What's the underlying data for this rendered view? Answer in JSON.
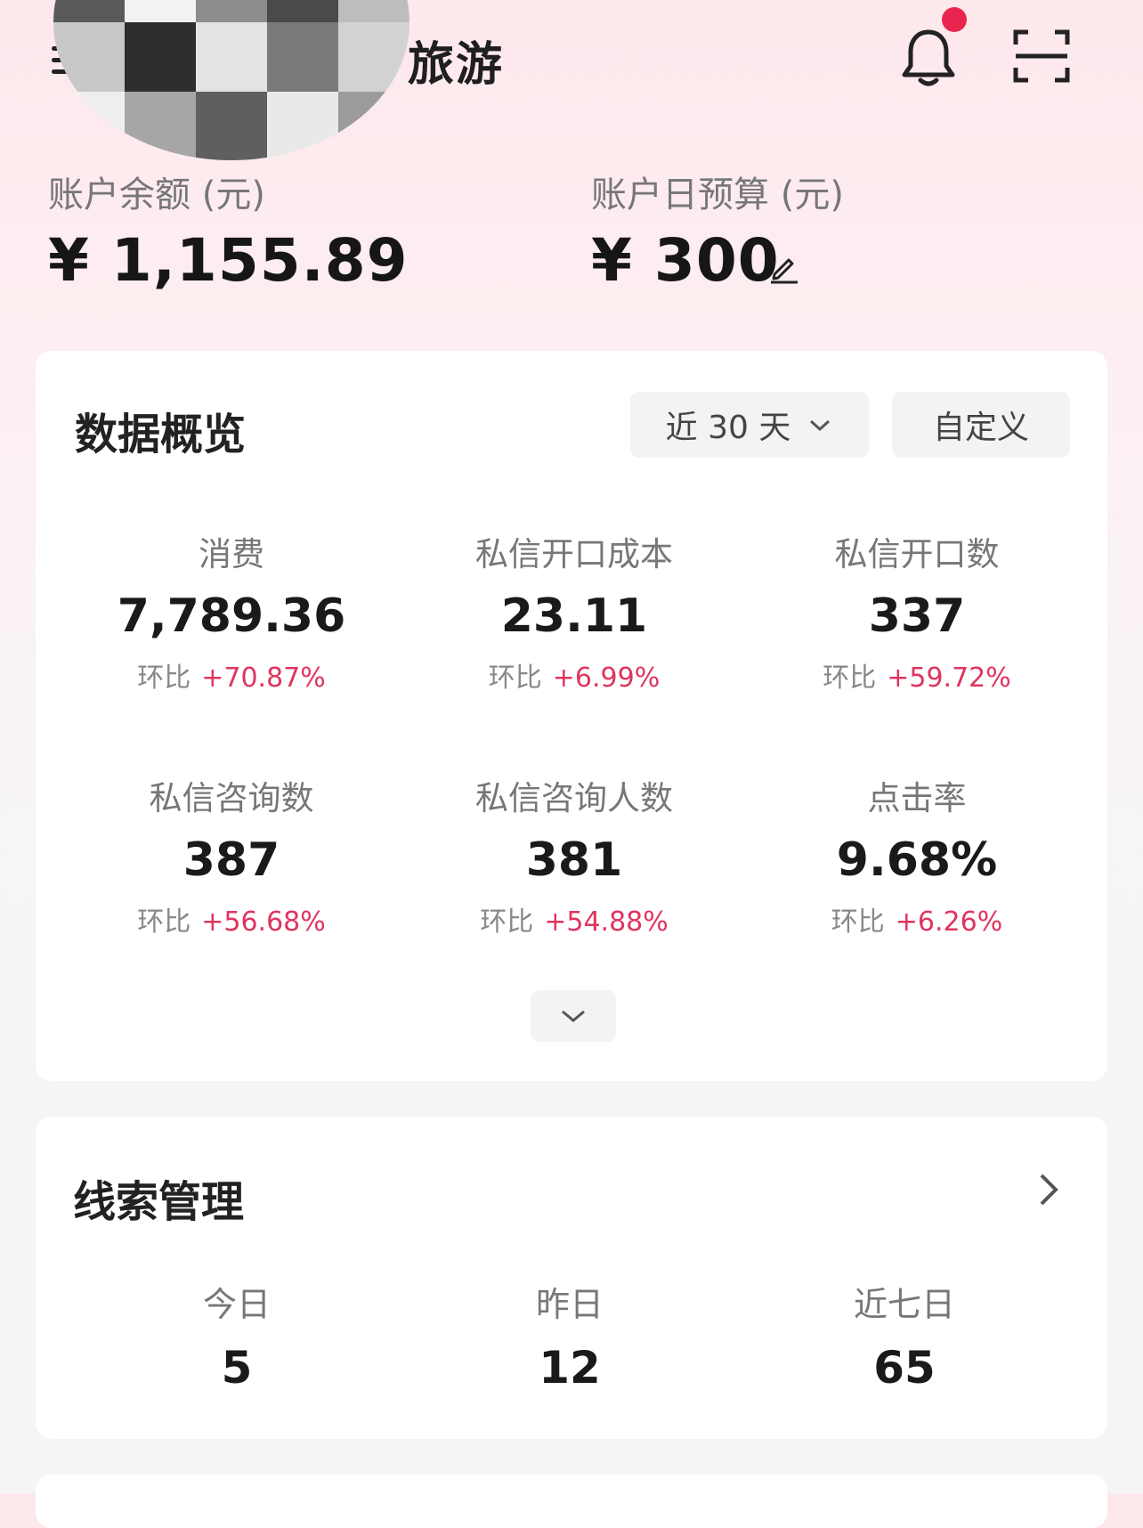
{
  "header": {
    "brand_partial": "旅游",
    "notification_has_unread": true,
    "accent_color": "#e8254f"
  },
  "account": {
    "balance_label": "账户余额 (元)",
    "balance_value": "¥ 1,155.89",
    "daily_budget_label": "账户日预算 (元)",
    "daily_budget_value": "¥ 300"
  },
  "overview": {
    "title": "数据概览",
    "range_label": "近 30 天",
    "custom_label": "自定义",
    "metrics": [
      {
        "label": "消费",
        "value": "7,789.36",
        "change_label": "环比",
        "change": "+70.87%"
      },
      {
        "label": "私信开口成本",
        "value": "23.11",
        "change_label": "环比",
        "change": "+6.99%"
      },
      {
        "label": "私信开口数",
        "value": "337",
        "change_label": "环比",
        "change": "+59.72%"
      },
      {
        "label": "私信咨询数",
        "value": "387",
        "change_label": "环比",
        "change": "+56.68%"
      },
      {
        "label": "私信咨询人数",
        "value": "381",
        "change_label": "环比",
        "change": "+54.88%"
      },
      {
        "label": "点击率",
        "value": "9.68%",
        "change_label": "环比",
        "change": "+6.26%"
      }
    ],
    "positive_color": "#e0345e"
  },
  "leads": {
    "title": "线索管理",
    "items": [
      {
        "label": "今日",
        "value": "5"
      },
      {
        "label": "昨日",
        "value": "12"
      },
      {
        "label": "近七日",
        "value": "65"
      }
    ]
  }
}
